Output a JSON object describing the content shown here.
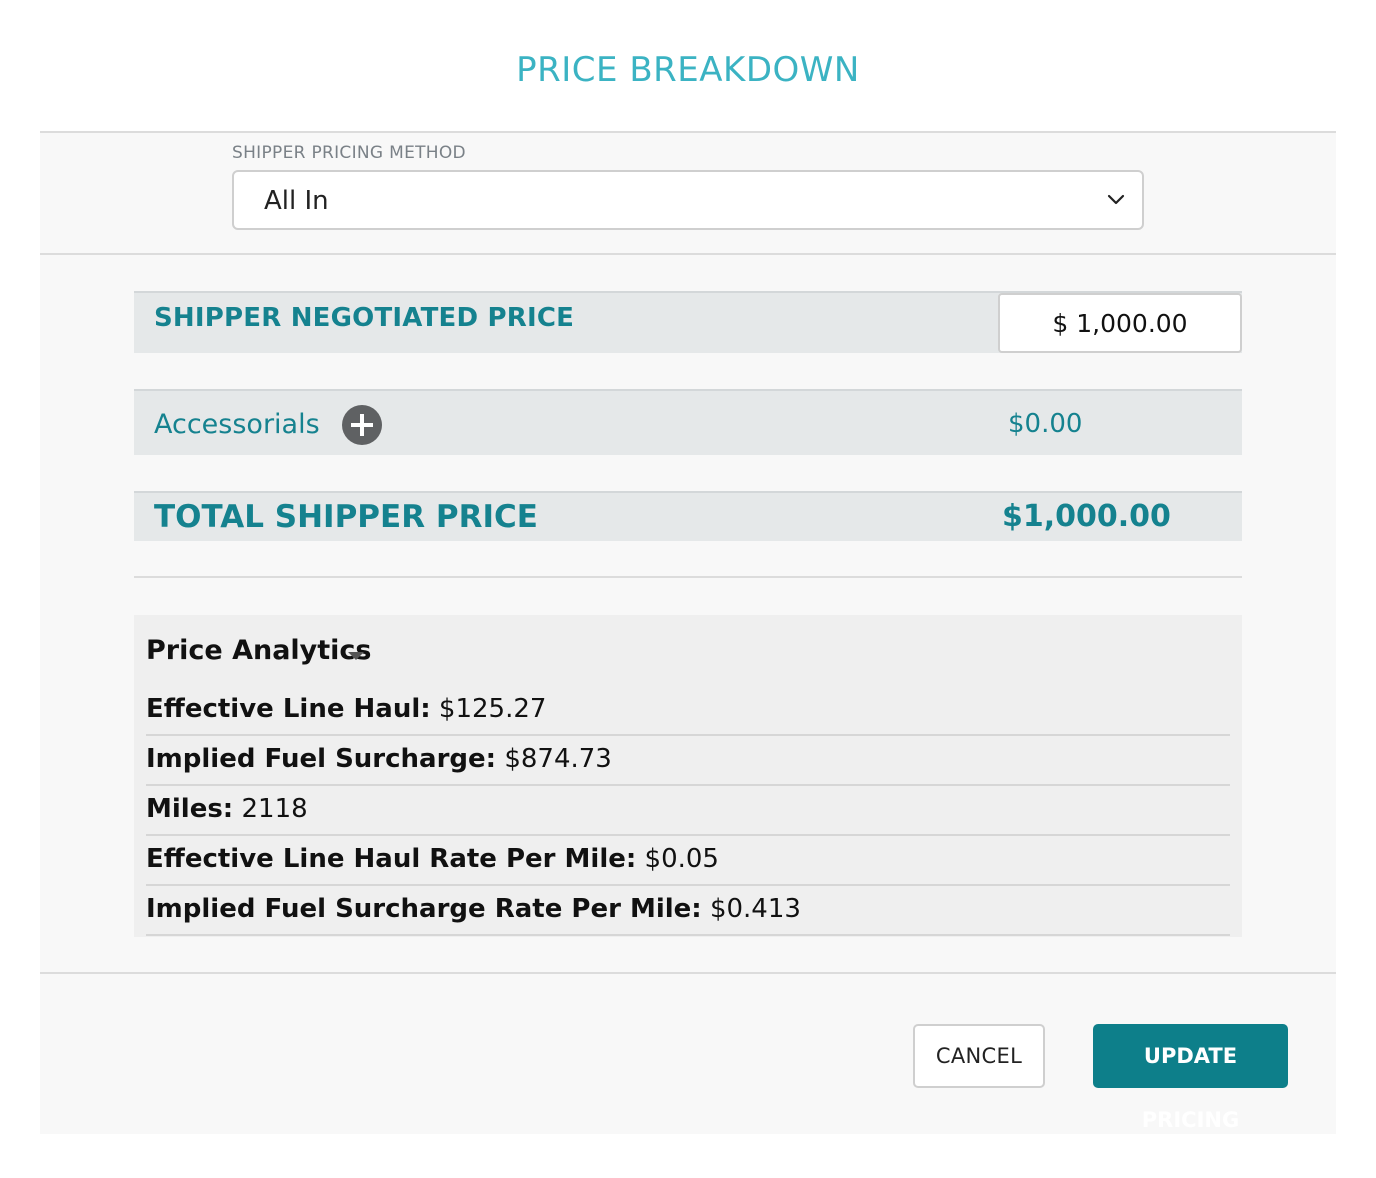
{
  "dialog": {
    "title": "PRICE BREAKDOWN"
  },
  "pricing_method": {
    "label": "SHIPPER PRICING METHOD",
    "selected": "All In",
    "icon": "chevron-down-icon"
  },
  "negotiated": {
    "label": "SHIPPER NEGOTIATED PRICE",
    "value": "$ 1,000.00"
  },
  "accessorials": {
    "label": "Accessorials",
    "icon": "plus-circle-icon",
    "value": "$0.00"
  },
  "total": {
    "label": "TOTAL SHIPPER PRICE",
    "value": "$1,000.00"
  },
  "analytics": {
    "header": "Price Analytics",
    "icon": "caret-down-icon",
    "rows": [
      {
        "label": "Effective Line Haul:",
        "value": " $125.27"
      },
      {
        "label": "Implied Fuel Surcharge:",
        "value": " $874.73"
      },
      {
        "label": "Miles:",
        "value": " 2118"
      },
      {
        "label": "Effective Line Haul Rate Per Mile:",
        "value": " $0.05"
      },
      {
        "label": "Implied Fuel Surcharge Rate Per Mile:",
        "value": " $0.413"
      }
    ]
  },
  "footer": {
    "cancel_label": "CANCEL",
    "update_label": "UPDATE PRICING"
  },
  "colors": {
    "title": "#3bb3c3",
    "accent_teal": "#15828f",
    "button_primary": "#0d7f8a"
  }
}
